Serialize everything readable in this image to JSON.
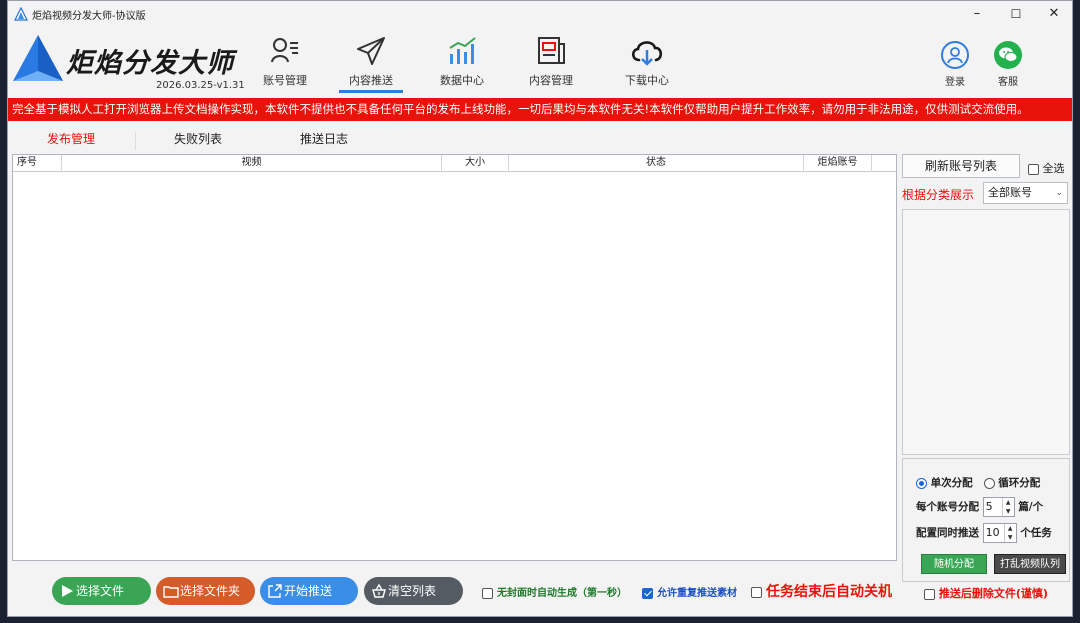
{
  "window": {
    "title": "炬焰视频分发大师-协议版",
    "controls": {
      "minimize": "–",
      "maximize": "☐",
      "close": "✕"
    }
  },
  "header": {
    "logo_text": "炬焰分发大师",
    "version": "2026.03.25-v1.31",
    "nav": [
      {
        "label": "账号管理",
        "icon": "user-list-icon"
      },
      {
        "label": "内容推送",
        "icon": "paper-plane-icon"
      },
      {
        "label": "数据中心",
        "icon": "bar-chart-icon"
      },
      {
        "label": "内容管理",
        "icon": "newspaper-icon"
      },
      {
        "label": "下载中心",
        "icon": "cloud-download-icon"
      }
    ],
    "active_nav": "内容推送",
    "login_label": "登录",
    "service_label": "客服"
  },
  "banner": {
    "text": "完全基于模拟人工打开浏览器上传文档操作实现，本软件不提供也不具备任何平台的发布上线功能，一切后果均与本软件无关!本软件仅帮助用户提升工作效率，请勿用于非法用途，仅供测试交流使用。"
  },
  "tabs": [
    {
      "label": "发布管理",
      "active": true
    },
    {
      "label": "失败列表",
      "active": false
    },
    {
      "label": "推送日志",
      "active": false
    }
  ],
  "table": {
    "columns": [
      "序号",
      "视频",
      "大小",
      "状态",
      "炬焰账号"
    ],
    "rows": []
  },
  "right_panel": {
    "refresh_label": "刷新账号列表",
    "select_all_label": "全选",
    "select_all_checked": false,
    "classify_label": "根据分类展示",
    "dropdown_value": "全部账号",
    "mode_single": "单次分配",
    "mode_cycle": "循环分配",
    "mode_selected": "single",
    "per_account_label": "每个账号分配",
    "per_account_value": "5",
    "per_account_unit": "篇/个",
    "concurrent_label": "配置同时推送",
    "concurrent_value": "10",
    "concurrent_unit": "个任务",
    "random_btn": "随机分配",
    "shuffle_btn": "打乱视频队列",
    "delete_after_label": "推送后删除文件(谨慎)",
    "delete_after_checked": false
  },
  "bottom": {
    "select_file": "选择文件",
    "select_folder": "选择文件夹",
    "start_push": "开始推送",
    "clear_list": "清空列表",
    "opt_cover": "无封面时自动生成（第一秒）",
    "opt_cover_checked": false,
    "opt_repeat": "允许重复推送素材",
    "opt_repeat_checked": true,
    "opt_shutdown": "任务结束后自动关机",
    "opt_shutdown_checked": false
  },
  "colors": {
    "accent": "#2f7de1",
    "banner_red": "#e8130b",
    "btn_green": "#3aa655",
    "btn_orange": "#d35c2a",
    "btn_blue": "#3a8ee6",
    "btn_gray": "#555b63"
  }
}
